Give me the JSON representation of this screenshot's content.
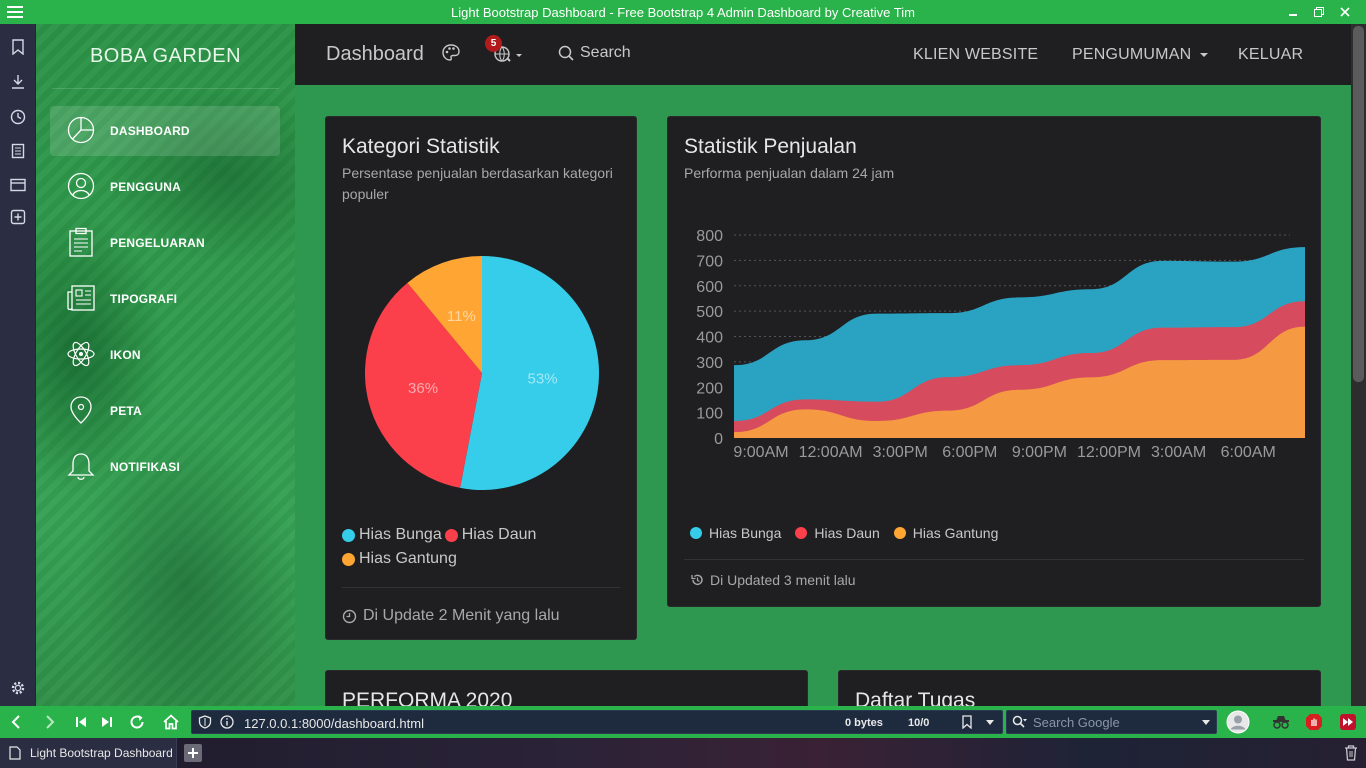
{
  "window": {
    "title": "Light Bootstrap Dashboard - Free Bootstrap 4 Admin Dashboard by Creative Tim"
  },
  "sidebar": {
    "brand": "BOBA GARDEN",
    "items": [
      {
        "label": "DASHBOARD",
        "icon": "chart-pie-icon",
        "active": true
      },
      {
        "label": "PENGGUNA",
        "icon": "user-circle-icon",
        "active": false
      },
      {
        "label": "PENGELUARAN",
        "icon": "clipboard-icon",
        "active": false
      },
      {
        "label": "TIPOGRAFI",
        "icon": "news-paper-icon",
        "active": false
      },
      {
        "label": "IKON",
        "icon": "atom-icon",
        "active": false
      },
      {
        "label": "PETA",
        "icon": "map-pin-icon",
        "active": false
      },
      {
        "label": "NOTIFIKASI",
        "icon": "bell-icon",
        "active": false
      }
    ]
  },
  "navbar": {
    "title": "Dashboard",
    "badge_count": "5",
    "search_label": "Search",
    "links": [
      "KLIEN WEBSITE",
      "PENGUMUMAN",
      "KELUAR"
    ]
  },
  "cards": {
    "kategori": {
      "title": "Kategori Statistik",
      "subtitle": "Persentase penjualan berdasarkan kategori populer",
      "footer": "Di Update 2 Menit yang lalu"
    },
    "penjualan": {
      "title": "Statistik Penjualan",
      "subtitle": "Performa penjualan dalam 24 jam",
      "footer": "Di Updated 3 menit lalu"
    },
    "performa": {
      "title": "PERFORMA 2020"
    },
    "tugas": {
      "title": "Daftar Tugas"
    }
  },
  "colors": {
    "hias_bunga": "#35cde9",
    "hias_daun": "#fb404b",
    "hias_gantung": "#ffa534",
    "sales_bunga": "#2aa3c3",
    "sales_daun": "#d64c5e",
    "sales_gantung": "#f59a43"
  },
  "chart_data": [
    {
      "type": "pie",
      "categories": [
        "Hias Bunga",
        "Hias Daun",
        "Hias Gantung"
      ],
      "values": [
        53,
        36,
        11
      ],
      "labels": [
        "53%",
        "36%",
        "11%"
      ]
    },
    {
      "type": "area",
      "x": [
        "9:00AM",
        "12:00AM",
        "3:00PM",
        "6:00PM",
        "9:00PM",
        "12:00PM",
        "3:00AM",
        "6:00AM"
      ],
      "ylim": [
        0,
        800
      ],
      "yticks": [
        0,
        100,
        200,
        300,
        400,
        500,
        600,
        700,
        800
      ],
      "grid": true,
      "legend": "bottom",
      "series": [
        {
          "name": "Hias Bunga",
          "values": [
            287,
            385,
            490,
            492,
            554,
            586,
            698,
            695,
            752
          ]
        },
        {
          "name": "Hias Daun",
          "values": [
            67,
            152,
            143,
            240,
            287,
            335,
            435,
            437,
            539
          ]
        },
        {
          "name": "Hias Gantung",
          "values": [
            23,
            113,
            67,
            108,
            190,
            239,
            307,
            308,
            439
          ]
        }
      ]
    }
  ],
  "browser": {
    "url": "127.0.0.1:8000/dashboard.html",
    "bytes": "0 bytes",
    "count": "10/0",
    "search_placeholder": "Search Google",
    "tab_title": "Light Bootstrap Dashboard"
  }
}
